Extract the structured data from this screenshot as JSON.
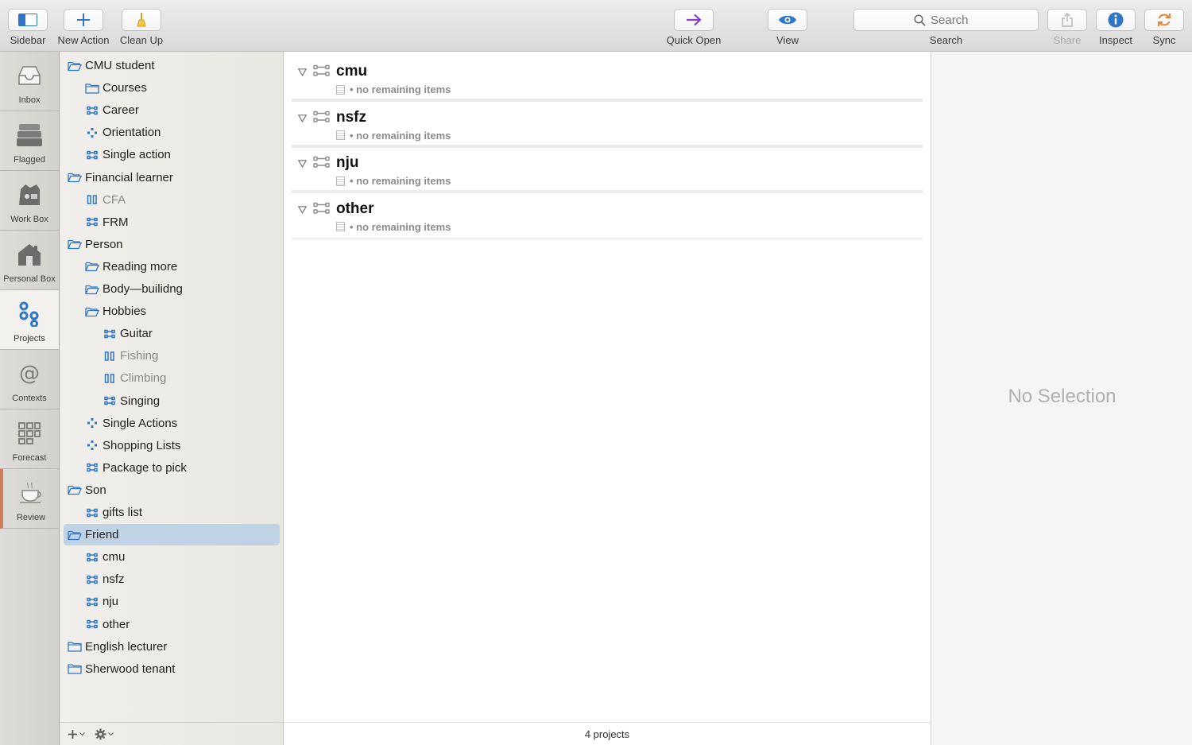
{
  "toolbar": {
    "sidebar_label": "Sidebar",
    "new_action_label": "New Action",
    "clean_up_label": "Clean Up",
    "quick_open_label": "Quick Open",
    "view_label": "View",
    "search_placeholder": "Search",
    "search_label": "Search",
    "share_label": "Share",
    "inspect_label": "Inspect",
    "sync_label": "Sync"
  },
  "perspectives": [
    {
      "label": "Inbox",
      "icon": "inbox-icon"
    },
    {
      "label": "Flagged",
      "icon": "flagged-icon"
    },
    {
      "label": "Work Box",
      "icon": "work-box-icon"
    },
    {
      "label": "Personal Box",
      "icon": "personal-box-icon"
    },
    {
      "label": "Projects",
      "icon": "projects-icon",
      "active": true
    },
    {
      "label": "Contexts",
      "icon": "contexts-icon"
    },
    {
      "label": "Forecast",
      "icon": "forecast-icon"
    },
    {
      "label": "Review",
      "icon": "review-icon"
    }
  ],
  "sidebar": {
    "items": [
      {
        "label": "CMU student",
        "type": "folder-open"
      },
      {
        "label": "Courses",
        "type": "folder"
      },
      {
        "label": "Career",
        "type": "sequential"
      },
      {
        "label": "Orientation",
        "type": "single-actions"
      },
      {
        "label": "Single action",
        "type": "sequential"
      },
      {
        "label": "Financial learner",
        "type": "folder-open"
      },
      {
        "label": "CFA",
        "type": "on-hold"
      },
      {
        "label": "FRM",
        "type": "sequential"
      },
      {
        "label": "Person",
        "type": "folder-open"
      },
      {
        "label": "Reading more",
        "type": "folder-open"
      },
      {
        "label": "Body—builidng",
        "type": "folder-open"
      },
      {
        "label": "Hobbies",
        "type": "folder-open"
      },
      {
        "label": "Guitar",
        "type": "sequential"
      },
      {
        "label": "Fishing",
        "type": "on-hold"
      },
      {
        "label": "Climbing",
        "type": "on-hold"
      },
      {
        "label": "Singing",
        "type": "sequential"
      },
      {
        "label": "Single Actions",
        "type": "single-actions"
      },
      {
        "label": "Shopping Lists",
        "type": "single-actions"
      },
      {
        "label": "Package to pick",
        "type": "sequential"
      },
      {
        "label": "Son",
        "type": "folder-open"
      },
      {
        "label": "gifts list",
        "type": "sequential"
      },
      {
        "label": "Friend",
        "type": "folder-open",
        "selected": true
      },
      {
        "label": "cmu",
        "type": "sequential"
      },
      {
        "label": "nsfz",
        "type": "sequential"
      },
      {
        "label": "nju",
        "type": "sequential"
      },
      {
        "label": "other",
        "type": "sequential"
      },
      {
        "label": "English lecturer",
        "type": "folder"
      },
      {
        "label": "Sherwood tenant",
        "type": "folder"
      }
    ]
  },
  "projects": [
    {
      "title": "cmu",
      "status": "no remaining items"
    },
    {
      "title": "nsfz",
      "status": "no remaining items"
    },
    {
      "title": "nju",
      "status": "no remaining items"
    },
    {
      "title": "other",
      "status": "no remaining items"
    }
  ],
  "main_footer": "4 projects",
  "inspector": {
    "empty_text": "No Selection"
  },
  "colors": {
    "accent": "#2f77c6",
    "selection": "#bfd3e5",
    "quick_open": "#8a3fc9",
    "sync": "#e8833a",
    "review": "#cf7d5a"
  }
}
